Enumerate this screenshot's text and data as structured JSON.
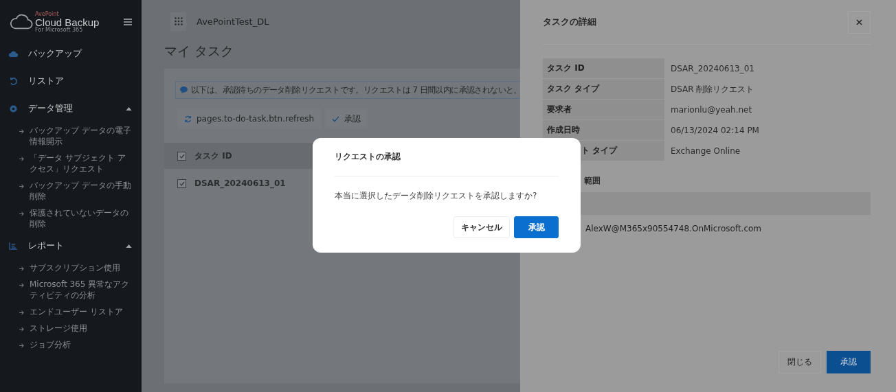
{
  "logo": {
    "brand": "AvePoint",
    "name": "Cloud Backup",
    "tagline": "For Microsoft 365"
  },
  "sidebar": {
    "items": [
      {
        "label": "バックアップ"
      },
      {
        "label": "リストア"
      },
      {
        "label": "データ管理",
        "expanded": true,
        "children": [
          {
            "label": "バックアップ データの電子情報開示"
          },
          {
            "label": "「データ サブジェクト アクセス」リクエスト"
          },
          {
            "label": "バックアップ データの手動削除"
          },
          {
            "label": "保護されていないデータの削除"
          }
        ]
      },
      {
        "label": "レポート",
        "expanded": true,
        "children": [
          {
            "label": "サブスクリプション使用"
          },
          {
            "label": "Microsoft 365 異常なアクティビティの分析"
          },
          {
            "label": "エンドユーザー リストア"
          },
          {
            "label": "ストレージ使用"
          },
          {
            "label": "ジョブ分析"
          }
        ]
      }
    ]
  },
  "header": {
    "tenant": "AvePointTest_DL"
  },
  "page_title": "マイ タスク",
  "banner": "以下は、承認待ちのデータ削除リクエストです。リクエストは 7 日間以内に承認されないと、",
  "toolbar": [
    {
      "kind": "refresh",
      "label": "pages.to-do-task.btn.refresh"
    },
    {
      "kind": "check",
      "label": "承認"
    }
  ],
  "table": {
    "columns": [
      {
        "label": "タスク ID",
        "checked": true
      }
    ],
    "rows": [
      {
        "task_id": "DSAR_20240613_01",
        "checked": true
      }
    ]
  },
  "drawer": {
    "title": "タスクの詳細",
    "details": [
      {
        "label": "タスク ID",
        "value": "DSAR_20240613_01"
      },
      {
        "label": "タスク タイプ",
        "value": "DSAR 削除リクエスト"
      },
      {
        "label": "要求者",
        "value": "marionlu@yeah.net"
      },
      {
        "label": "作成日時",
        "value": "06/13/2024 02:14 PM"
      },
      {
        "label": "ト タイプ",
        "value": "Exchange Online"
      }
    ],
    "scope_title": "範囲",
    "scope_rows": [
      "AlexW@M365x90554748.OnMicrosoft.com"
    ],
    "buttons": [
      {
        "label": "閉じる",
        "primary": false
      },
      {
        "label": "承認",
        "primary": true
      }
    ]
  },
  "dialog": {
    "title": "リクエストの承認",
    "message": "本当に選択したデータ削除リクエストを承認しますか?",
    "buttons": [
      {
        "label": "キャンセル",
        "primary": false
      },
      {
        "label": "承認",
        "primary": true
      }
    ]
  }
}
